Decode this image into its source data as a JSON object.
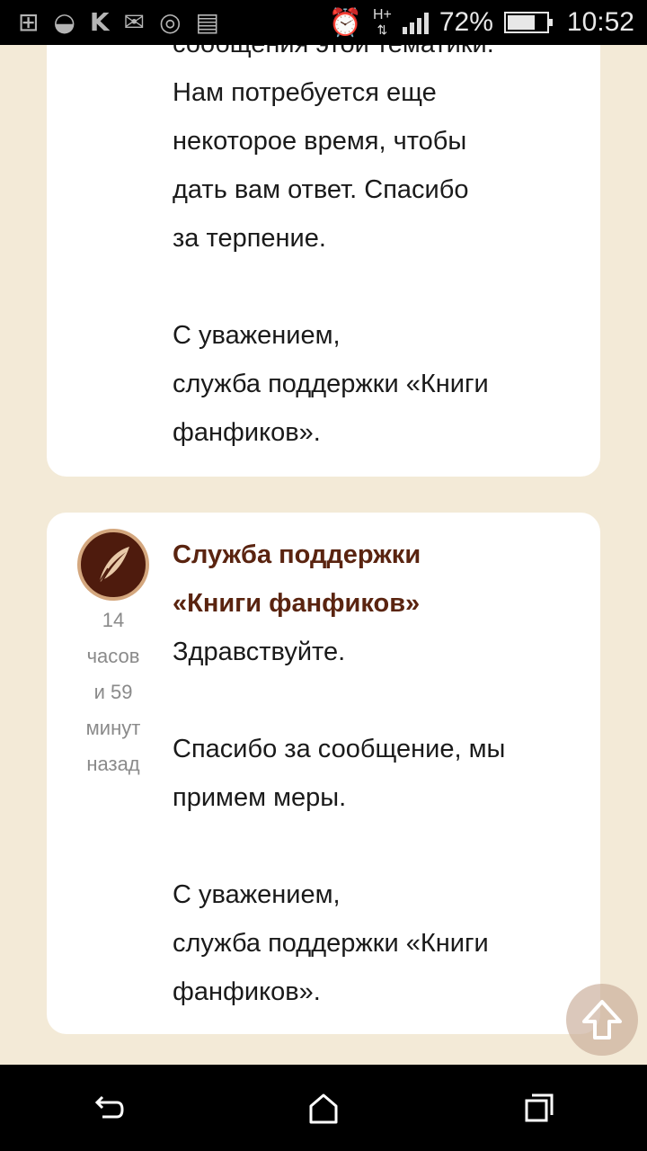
{
  "status_bar": {
    "battery_percent": "72%",
    "battery_level": 0.72,
    "time": "10:52",
    "network_type": "H+",
    "left_icons": [
      "add-notification-icon",
      "sberbank-icon",
      "vk-icon",
      "gmail-icon",
      "instagram-icon",
      "keyboard-icon"
    ],
    "right_icons": [
      "alarm-icon",
      "network-type-icon",
      "signal-icon",
      "battery-icon"
    ]
  },
  "message1": {
    "lines_a": [
      "сообщения этой тематики.",
      "Нам потребуется еще",
      "некоторое время, чтобы",
      "дать вам ответ. Спасибо",
      "за терпение."
    ],
    "lines_b": [
      "С уважением,",
      "служба поддержки «Книги",
      "фанфиков»."
    ]
  },
  "message2": {
    "author_line1": "Служба поддержки",
    "author_line2": "«Книги фанфиков»",
    "time_ago": [
      "14",
      "часов",
      "и 59",
      "минут",
      "назад"
    ],
    "greeting": "Здравствуйте.",
    "body_line1": "Спасибо за сообщение, мы",
    "body_line2": "примем меры.",
    "sign_line1": "С уважением,",
    "sign_line2": "служба поддержки «Книги",
    "sign_line3": "фанфиков»."
  },
  "colors": {
    "page_background": "#f3ead7",
    "card_background": "#ffffff",
    "author_color": "#5a2410",
    "avatar_background": "#4e1b0d",
    "avatar_border": "#d4a77e"
  }
}
